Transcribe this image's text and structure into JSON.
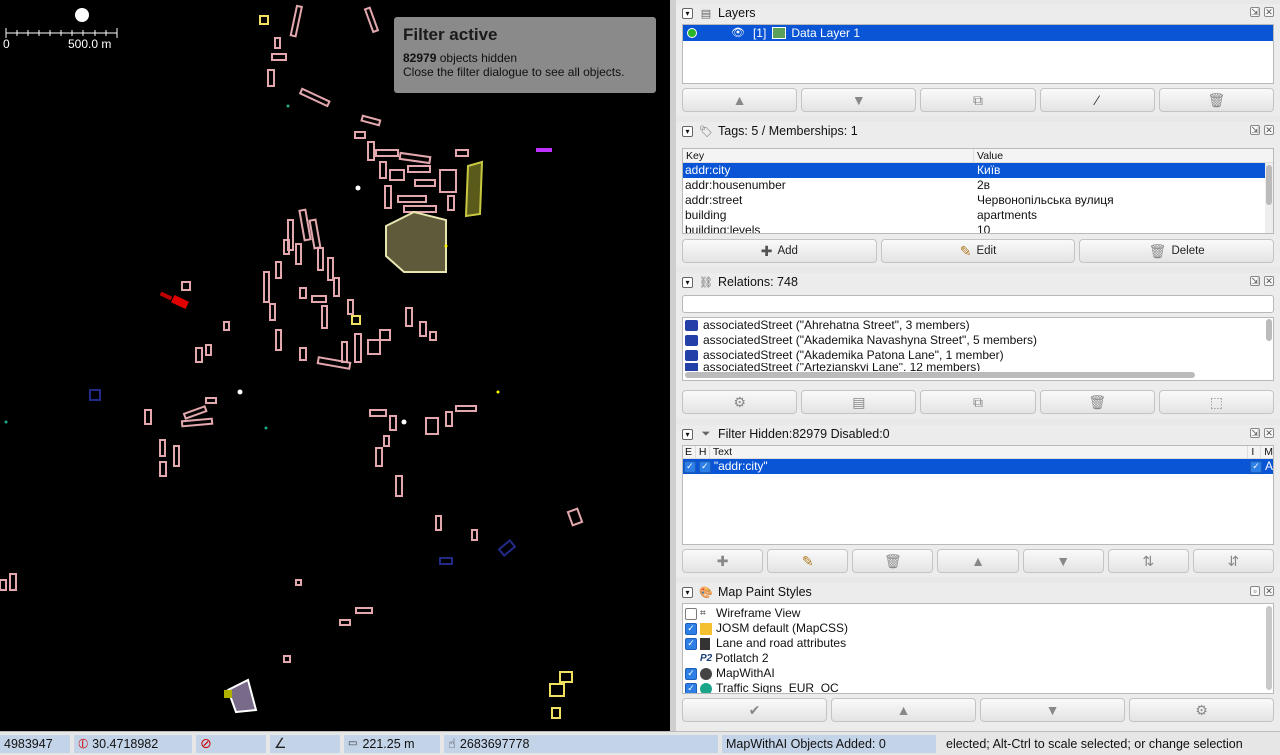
{
  "map": {
    "scale": {
      "left_label": "0",
      "right_label": "500.0 m"
    },
    "filter_popup": {
      "title": "Filter active",
      "count": "82979",
      "hidden_text": "objects hidden",
      "close_hint": "Close the filter dialogue to see all objects."
    }
  },
  "layers": {
    "title": "Layers",
    "items": [
      {
        "index": "[1]",
        "name": "Data Layer 1",
        "visible": true,
        "active": true
      }
    ],
    "buttons": [
      "move-up",
      "move-down",
      "merge",
      "activate",
      "delete"
    ]
  },
  "tags": {
    "title": "Tags: 5 / Memberships: 1",
    "columns": {
      "key": "Key",
      "value": "Value"
    },
    "rows": [
      {
        "key": "addr:city",
        "value": "Київ",
        "selected": true
      },
      {
        "key": "addr:housenumber",
        "value": "2в"
      },
      {
        "key": "addr:street",
        "value": "Червонопільська вулиця"
      },
      {
        "key": "building",
        "value": "apartments"
      },
      {
        "key": "building:levels",
        "value": "10"
      }
    ],
    "buttons": {
      "add": "Add",
      "edit": "Edit",
      "delete": "Delete"
    }
  },
  "relations": {
    "title": "Relations: 748",
    "filter_value": "",
    "items": [
      "associatedStreet (\"Ahrehatna Street\", 3 members)",
      "associatedStreet (\"Akademika Navashyna Street\", 5 members)",
      "associatedStreet (\"Akademika Patona Lane\", 1 member)",
      "associatedStreet (\"Artezianskyi Lane\", 12 members)"
    ]
  },
  "filter": {
    "title": "Filter Hidden:82979 Disabled:0",
    "columns": {
      "e": "E",
      "h": "H",
      "text": "Text",
      "i": "I",
      "m": "M"
    },
    "rows": [
      {
        "text": "\"addr:city\"",
        "enabled": true,
        "hiding": true,
        "inverted": true,
        "mode": "A"
      }
    ]
  },
  "paint_styles": {
    "title": "Map Paint Styles",
    "items": [
      {
        "name": "Wireframe View",
        "checked": false,
        "icon": "wireframe-icon"
      },
      {
        "name": "JOSM default (MapCSS)",
        "checked": true,
        "icon": "josm-icon"
      },
      {
        "name": "Lane and road attributes",
        "checked": true,
        "icon": "lane-icon"
      },
      {
        "name": "Potlatch 2",
        "checked": false,
        "icon": "potlatch-icon",
        "badge": "P2"
      },
      {
        "name": "MapWithAI",
        "checked": true,
        "icon": "mapwithai-icon"
      },
      {
        "name": "Traffic Signs_EUR_OC",
        "checked": true,
        "icon": "traffic-sign-icon"
      }
    ]
  },
  "status": {
    "lat": "4983947",
    "lon": "30.4718982",
    "distance": "221.25 m",
    "id": "2683697778",
    "mapwithai": "MapWithAI Objects Added: 0",
    "hint": "elected; Alt-Ctrl to scale selected; or change selection"
  },
  "colors": {
    "selection": "#0a55d6",
    "building_outline": "#e8a8b0",
    "map_bg": "#000000"
  }
}
